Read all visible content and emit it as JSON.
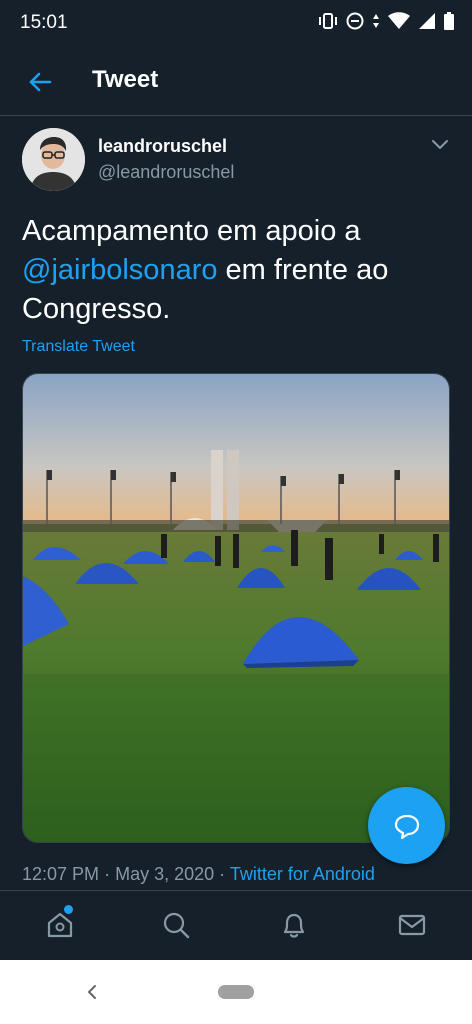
{
  "status_bar": {
    "time": "15:01",
    "icons": [
      "vibrate-icon",
      "dnd-icon",
      "data-arrows-icon",
      "wifi-icon",
      "signal-icon",
      "battery-icon"
    ]
  },
  "header": {
    "back_icon": "arrow-left-icon",
    "title": "Tweet"
  },
  "tweet": {
    "author": {
      "display_name": "leandroruschel",
      "handle": "@leandroruschel"
    },
    "text_before": "Acampamento em apoio a ",
    "mention": "@jairbolsonaro",
    "text_after": " em frente ao Congresso.",
    "translate_label": "Translate Tweet",
    "media_description_icon": "photo-tents-congress",
    "time": "12:07 PM",
    "separator": "·",
    "date": "May 3, 2020",
    "source": "Twitter for Android"
  },
  "fab": {
    "icon": "reply-bubble-icon"
  },
  "bottom_nav": {
    "items": [
      {
        "name": "home",
        "icon": "home-icon",
        "has_notification_dot": true
      },
      {
        "name": "search",
        "icon": "search-icon"
      },
      {
        "name": "notifications",
        "icon": "bell-icon"
      },
      {
        "name": "messages",
        "icon": "envelope-icon"
      }
    ]
  },
  "colors": {
    "background": "#15202b",
    "accent": "#1da1f2",
    "secondary_text": "#8899a6",
    "divider": "#38444d"
  }
}
